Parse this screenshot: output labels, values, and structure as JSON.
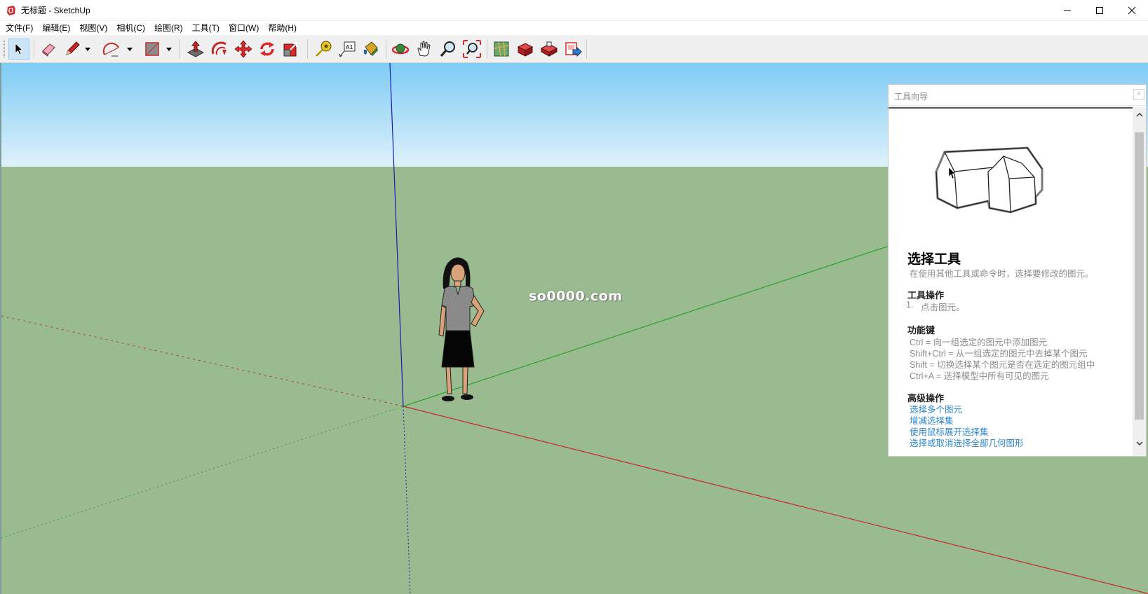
{
  "window": {
    "title": "无标题 - SketchUp",
    "controls": [
      "minimize",
      "maximize",
      "close"
    ]
  },
  "menu": [
    {
      "label": "文件(F)"
    },
    {
      "label": "编辑(E)"
    },
    {
      "label": "视图(V)"
    },
    {
      "label": "相机(C)"
    },
    {
      "label": "绘图(R)"
    },
    {
      "label": "工具(T)"
    },
    {
      "label": "窗口(W)"
    },
    {
      "label": "帮助(H)"
    }
  ],
  "toolbar": {
    "tools": [
      {
        "name": "select-tool",
        "icon": "arrow-cursor-icon",
        "active": true
      },
      {
        "name": "eraser-tool",
        "icon": "eraser-icon"
      },
      {
        "name": "line-tool",
        "icon": "pencil-icon"
      },
      {
        "name": "arc-tool",
        "icon": "arc-icon"
      },
      {
        "name": "rectangle-tool",
        "icon": "rectangle-icon"
      },
      {
        "name": "push-pull-tool",
        "icon": "push-pull-icon"
      },
      {
        "name": "offset-tool",
        "icon": "offset-icon"
      },
      {
        "name": "move-tool",
        "icon": "move-icon"
      },
      {
        "name": "rotate-tool",
        "icon": "rotate-icon"
      },
      {
        "name": "scale-tool",
        "icon": "scale-icon"
      },
      {
        "name": "tape-measure-tool",
        "icon": "tape-measure-icon"
      },
      {
        "name": "text-tool",
        "icon": "text-icon"
      },
      {
        "name": "paint-bucket-tool",
        "icon": "paint-bucket-icon"
      },
      {
        "name": "orbit-tool",
        "icon": "orbit-icon"
      },
      {
        "name": "pan-tool",
        "icon": "hand-icon"
      },
      {
        "name": "zoom-tool",
        "icon": "magnifier-icon"
      },
      {
        "name": "zoom-extents-tool",
        "icon": "zoom-extents-icon"
      },
      {
        "name": "3d-warehouse-tool",
        "icon": "warehouse-icon"
      },
      {
        "name": "extension-warehouse-tool",
        "icon": "extension-icon"
      },
      {
        "name": "sketchup-share-tool",
        "icon": "share-icon"
      },
      {
        "name": "layout-send-tool",
        "icon": "layout-icon"
      }
    ],
    "text_tool_glyph": "A1"
  },
  "viewport": {
    "watermark": "so0000.com",
    "colors": {
      "sky_top": "#7ecbf5",
      "ground": "#99bb8f",
      "red_axis": "#c62828",
      "green_axis": "#2ea12e",
      "blue_axis": "#1a1ab0"
    }
  },
  "instructor": {
    "title": "工具向导",
    "close": "×",
    "tool_name": "选择工具",
    "tool_desc": "在使用其他工具或命令时，选择要修改的图元。",
    "operations_heading": "工具操作",
    "operations": [
      {
        "num": "1.",
        "text": "点击图元。"
      }
    ],
    "modifiers_heading": "功能键",
    "modifiers": [
      "Ctrl = 向一组选定的图元中添加图元",
      "Shift+Ctrl = 从一组选定的图元中去掉某个图元",
      "Shift = 切换选择某个图元是否在选定的图元组中",
      "Ctrl+A = 选择模型中所有可见的图元"
    ],
    "advanced_heading": "高级操作",
    "advanced_links": [
      "选择多个图元",
      "增减选择集",
      "使用鼠标展开选择集",
      "选择或取消选择全部几何图形"
    ]
  }
}
